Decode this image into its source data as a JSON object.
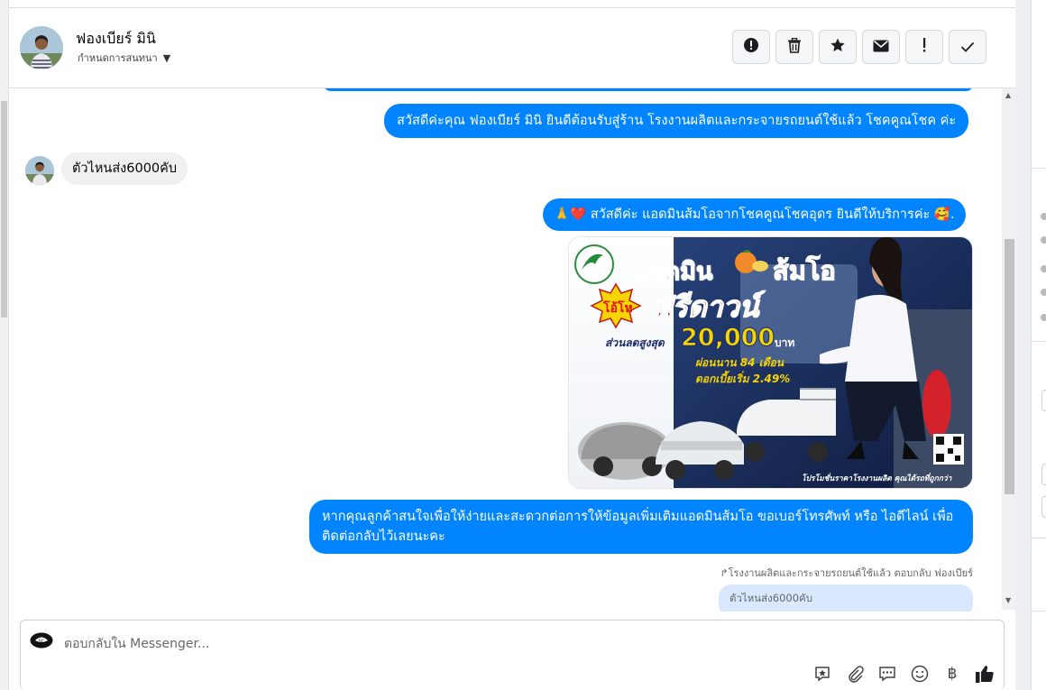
{
  "contact": {
    "name": "ฟองเบียร์ มินิ",
    "assign_label": "กำหนดการสนทนา"
  },
  "header_actions": [
    {
      "icon": "alert-circle-icon"
    },
    {
      "icon": "trash-icon"
    },
    {
      "icon": "star-icon"
    },
    {
      "icon": "envelope-icon"
    },
    {
      "icon": "exclamation-icon"
    },
    {
      "icon": "checkmark-icon"
    }
  ],
  "messages": {
    "welcome": "สวัสดีค่ะคุณ ฟองเบียร์ มินิ ยินดีต้อนรับสู่ร้าน โรงงานผลิตและกระจายรถยนต์ใช้แล้ว โชคคูณโชค ค่ะ",
    "customer_question": "ตัวไหนส่ง6000คับ",
    "greeting": "🙏❤️ สวัสดีค่ะ แอดมินส้มโอจากโชคคูณโชคอุดร ยินดีให้บริการค่ะ 🥰.",
    "followup": "หากคุณลูกค้าสนใจเพื่อให้ง่ายและสะดวกต่อการให้ข้อมูลเพิ่มเติมแอดมินส้มโอ ขอเบอร์โทรศัพท์ หรือ ไอดีไลน์ เพื่อติดต่อกลับไว้เลยนะคะ",
    "reply_note": "โรงงานผลิตและกระจายรถยนต์ใช้แล้ว ตอบกลับ ฟองเบียร์",
    "reply_quote": "ตัวไหนส่ง6000คับ"
  },
  "promo": {
    "headline_left": "แอดมิน",
    "headline_right": "ส้มโอ",
    "badge": "โอ้โห",
    "free_down": "ฟรีดาวน์",
    "discount_label": "ส่วนลดสูงสุด",
    "discount_value": "20,000",
    "discount_unit": "บาท",
    "installment": "ผ่อนนาน 84 เดือน",
    "interest": "ดอกเบี้ยเริ่ม 2.49%",
    "footer": "โปรโมชั่นราคาโรงงานผลิต คุณได้รถที่ถูกกว่า",
    "colors": {
      "title": "#e4121b",
      "gold": "#f5d400",
      "navy": "#1a2b6a"
    }
  },
  "composer": {
    "placeholder": "ตอบกลับใน Messenger...",
    "tools": [
      "saved-reply-icon",
      "attachment-icon",
      "chat-bubble-icon",
      "emoji-icon",
      "baht-icon",
      "thumbs-up-icon"
    ]
  },
  "colors": {
    "outgoing_bubble": "#0084ff",
    "incoming_bubble": "#f0f0f0"
  }
}
